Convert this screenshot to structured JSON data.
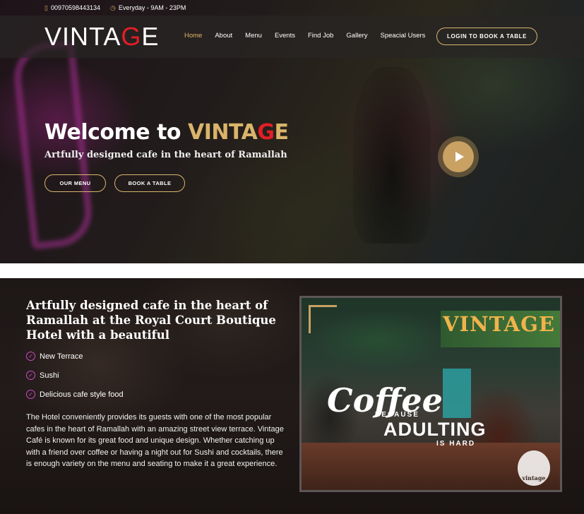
{
  "topbar": {
    "phone": "00970598443134",
    "hours": "Everyday - 9AM - 23PM"
  },
  "nav": {
    "logo_main": "VINTA",
    "logo_accent": "G",
    "logo_end": "E",
    "items": [
      "Home",
      "About",
      "Menu",
      "Events",
      "Find Job",
      "Gallery",
      "Speacial Users"
    ],
    "active": "Home",
    "login_label": "LOGIN TO BOOK A TABLE"
  },
  "hero": {
    "title_prefix": "Welcome to ",
    "brand_main": "VINTA",
    "brand_accent": "G",
    "brand_end": "E",
    "subtitle": "Artfully designed cafe in the heart of Ramallah",
    "menu_button": "OUR MENU",
    "book_button": "BOOK A TABLE"
  },
  "about": {
    "title": "Artfully designed cafe in the heart of Ramallah at the Royal Court Boutique Hotel with a beautiful",
    "features": [
      "New Terrace",
      "Sushi",
      "Delicious cafe style food"
    ],
    "body": "The Hotel conveniently provides its guests with one of the most popular cafes in the heart of Ramallah with an amazing street view terrace. Vintage Café is known for its great food and unique design. Whether catching up with a friend over coffee or having a night out for Sushi and cocktails, there is enough variety on the menu and seating to make it a great experience."
  },
  "photo": {
    "sign": "VINTAGE",
    "coffee": "Coffee",
    "because": "BECAUSE",
    "adulting": "ADULTING",
    "is_hard": "IS HARD",
    "mini_logo": "vintage"
  },
  "colors": {
    "gold": "#d9b46a",
    "red_accent": "#e41e26",
    "check_magenta": "#d447c9"
  },
  "icons": {
    "phone": "phone-icon",
    "clock": "clock-icon",
    "play": "play-icon",
    "check": "check-circle-icon"
  }
}
